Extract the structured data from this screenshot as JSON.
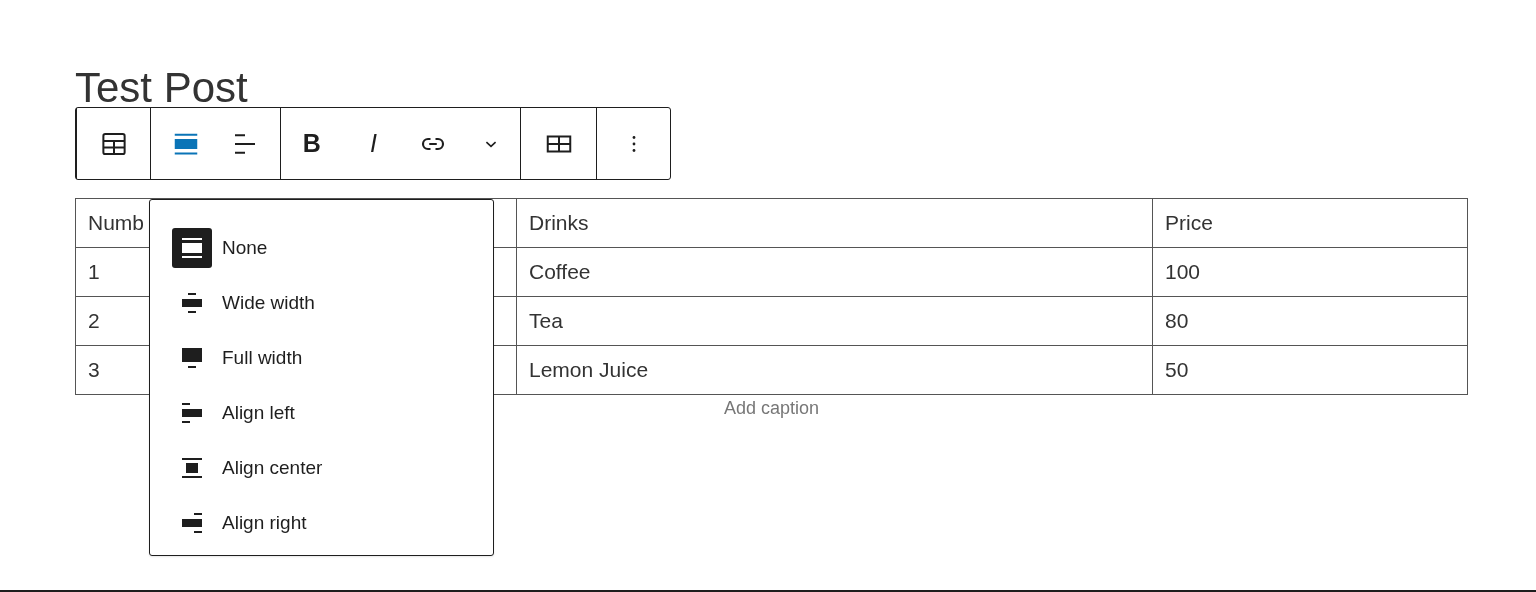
{
  "post_title": "Test Post",
  "toolbar": {
    "groups": [
      {
        "buttons": [
          {
            "kind": "table"
          }
        ]
      },
      {
        "buttons": [
          {
            "kind": "align",
            "selected": true
          },
          {
            "kind": "text-align",
            "selected": false
          }
        ]
      },
      {
        "buttons": [
          {
            "kind": "bold",
            "label": "B"
          },
          {
            "kind": "italic",
            "label": "I"
          },
          {
            "kind": "link"
          },
          {
            "kind": "chevron"
          }
        ]
      },
      {
        "buttons": [
          {
            "kind": "table-edit"
          }
        ]
      },
      {
        "buttons": [
          {
            "kind": "more"
          }
        ]
      }
    ]
  },
  "table": {
    "columns": [
      "Numb",
      "Drinks",
      "Price"
    ],
    "rows": [
      [
        "1",
        "Coffee",
        "100"
      ],
      [
        "2",
        "Tea",
        "80"
      ],
      [
        "3",
        "Lemon Juice",
        "50"
      ]
    ],
    "caption_placeholder": "Add caption"
  },
  "align_menu": [
    {
      "label": "None",
      "kind": "none",
      "selected": true
    },
    {
      "label": "Wide width",
      "kind": "wide",
      "selected": false
    },
    {
      "label": "Full width",
      "kind": "full",
      "selected": false
    },
    {
      "label": "Align left",
      "kind": "left",
      "selected": false
    },
    {
      "label": "Align center",
      "kind": "center",
      "selected": false
    },
    {
      "label": "Align right",
      "kind": "right",
      "selected": false
    }
  ]
}
